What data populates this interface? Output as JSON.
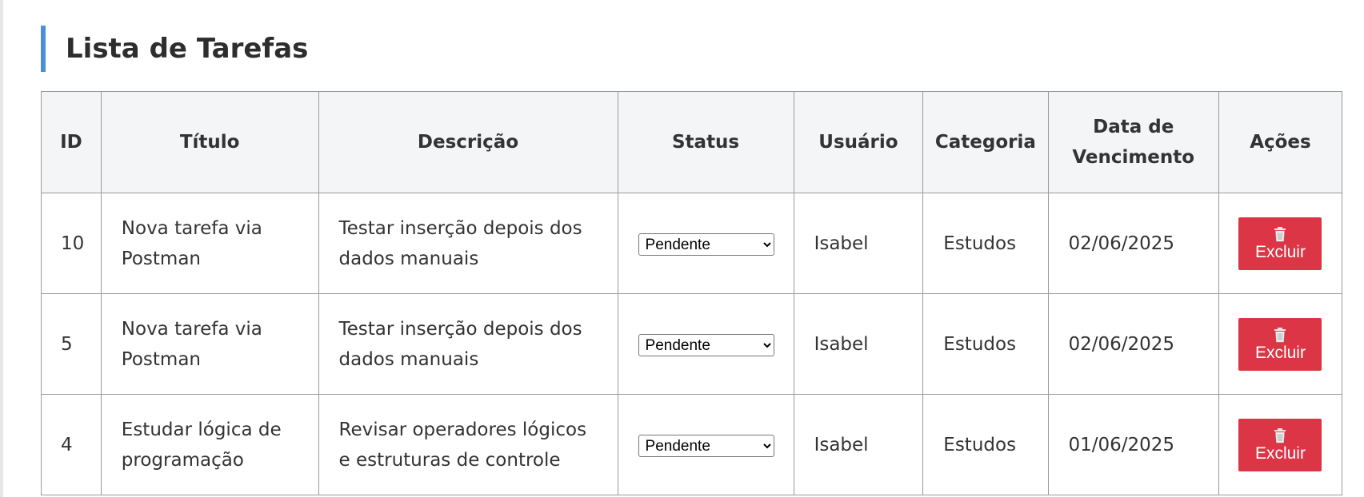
{
  "page": {
    "title": "Lista de Tarefas"
  },
  "table": {
    "headers": [
      "ID",
      "Título",
      "Descrição",
      "Status",
      "Usuário",
      "Categoria",
      "Data de Vencimento",
      "Ações"
    ],
    "rows": [
      {
        "id": "10",
        "titulo": "Nova tarefa via Postman",
        "descricao": "Testar inserção depois dos dados manuais",
        "status": "Pendente",
        "usuario": "Isabel",
        "categoria": "Estudos",
        "vencimento": "02/06/2025",
        "acao": "Excluir"
      },
      {
        "id": "5",
        "titulo": "Nova tarefa via Postman",
        "descricao": "Testar inserção depois dos dados manuais",
        "status": "Pendente",
        "usuario": "Isabel",
        "categoria": "Estudos",
        "vencimento": "02/06/2025",
        "acao": "Excluir"
      },
      {
        "id": "4",
        "titulo": "Estudar lógica de programação",
        "descricao": "Revisar operadores lógicos e estruturas de controle",
        "status": "Pendente",
        "usuario": "Isabel",
        "categoria": "Estudos",
        "vencimento": "01/06/2025",
        "acao": "Excluir"
      }
    ]
  },
  "icons": {
    "delete": "trash-icon",
    "dropdown": "chevron-down-icon"
  },
  "colors": {
    "accent": "#4a90d9",
    "danger": "#dc3545",
    "header_bg": "#f4f5f7"
  }
}
